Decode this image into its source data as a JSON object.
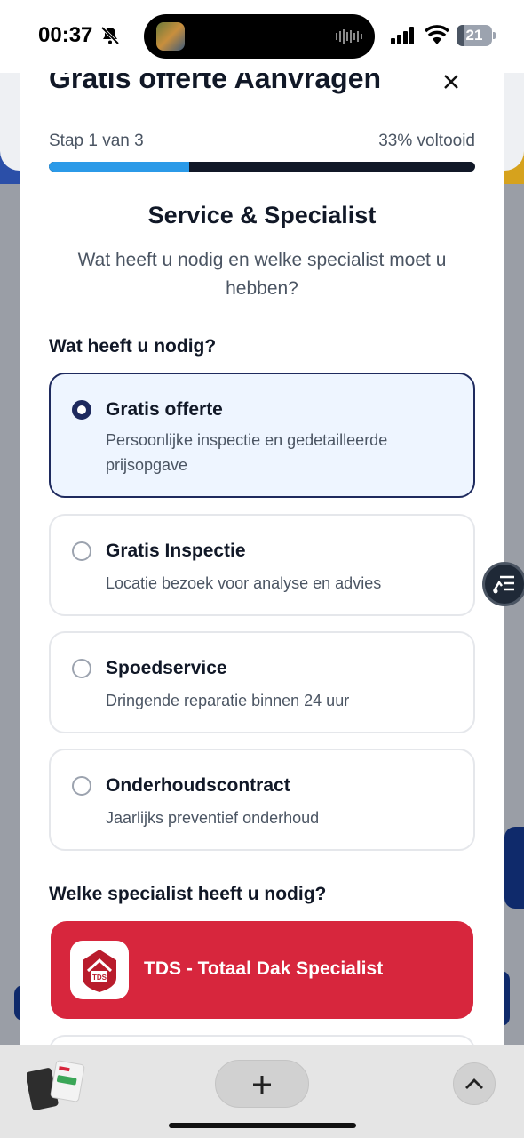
{
  "status_bar": {
    "time": "00:37",
    "battery_level": "21",
    "icons": [
      "bell-slash-icon",
      "signal-icon",
      "wifi-icon",
      "battery-icon"
    ]
  },
  "modal": {
    "title": "Gratis offerte Aanvragen",
    "close_icon": "close-icon",
    "step_label": "Stap 1 van 3",
    "percent_label": "33% voltooid",
    "progress_fraction": 0.33,
    "section_title": "Service & Specialist",
    "section_subtitle": "Wat heeft u nodig en welke specialist moet u hebben?",
    "question1": "Wat heeft u nodig?",
    "options": [
      {
        "title": "Gratis offerte",
        "desc": "Persoonlijke inspectie en gedetailleerde prijsopgave",
        "selected": true
      },
      {
        "title": "Gratis Inspectie",
        "desc": "Locatie bezoek voor analyse en advies",
        "selected": false
      },
      {
        "title": "Spoedservice",
        "desc": "Dringende reparatie binnen 24 uur",
        "selected": false
      },
      {
        "title": "Onderhoudscontract",
        "desc": "Jaarlijks preventief onderhoud",
        "selected": false
      }
    ],
    "question2": "Welke specialist heeft u nodig?",
    "specialist": {
      "name": "TDS - Totaal Dak Specialist",
      "logo_text": "TDS"
    }
  },
  "colors": {
    "accent_blue": "#2b9ae8",
    "navy": "#1e2a5e",
    "specialist_red": "#d7263d"
  },
  "bottom_bar": {
    "plus_icon": "plus-icon",
    "chevron_icon": "chevron-up-icon",
    "tabs_icon": "tab-overview-icon"
  }
}
